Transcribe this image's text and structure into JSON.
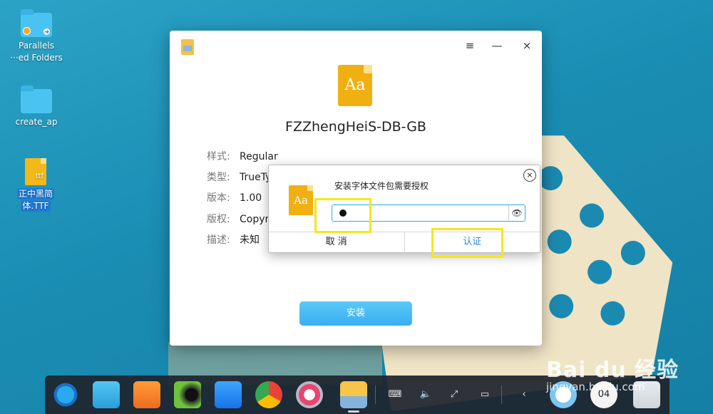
{
  "desktop": {
    "icons": [
      {
        "label_line1": "Parallels",
        "label_line2": "···ed Folders"
      },
      {
        "label_line1": "create_ap"
      },
      {
        "label_line1": "正中黑简",
        "label_line2": "体.TTF",
        "file_ext": "ttf"
      }
    ]
  },
  "window": {
    "menu_icon": "≡",
    "minimize_icon": "—",
    "close_icon": "×",
    "file_icon_text": "Aa",
    "font_name": "FZZhengHeiS-DB-GB",
    "info": [
      {
        "key": "样式:",
        "value": "Regular"
      },
      {
        "key": "类型:",
        "value": "TrueTy"
      },
      {
        "key": "版本:",
        "value": "1.00"
      },
      {
        "key": "版权:",
        "value": "Copyr"
      },
      {
        "key": "描述:",
        "value": "未知"
      }
    ],
    "install_label": "安装"
  },
  "auth_dialog": {
    "close_icon": "×",
    "icon_text": "Aa",
    "title": "安装字体文件包需要授权",
    "password_visible_icon": "eye-icon",
    "cancel_label": "取 消",
    "confirm_label": "认证"
  },
  "dock": {
    "apps": [
      "deepin-launcher",
      "file-manager",
      "app-store",
      "music",
      "video",
      "chrome",
      "settings",
      "font-installer"
    ],
    "clock_text": "04"
  },
  "watermark": {
    "brand": "Bai du 经验",
    "url": "jingyan.baidu.com"
  },
  "colors": {
    "accent": "#2ca7f8",
    "highlight": "#f6e61d",
    "file_icon": "#f1b012"
  }
}
